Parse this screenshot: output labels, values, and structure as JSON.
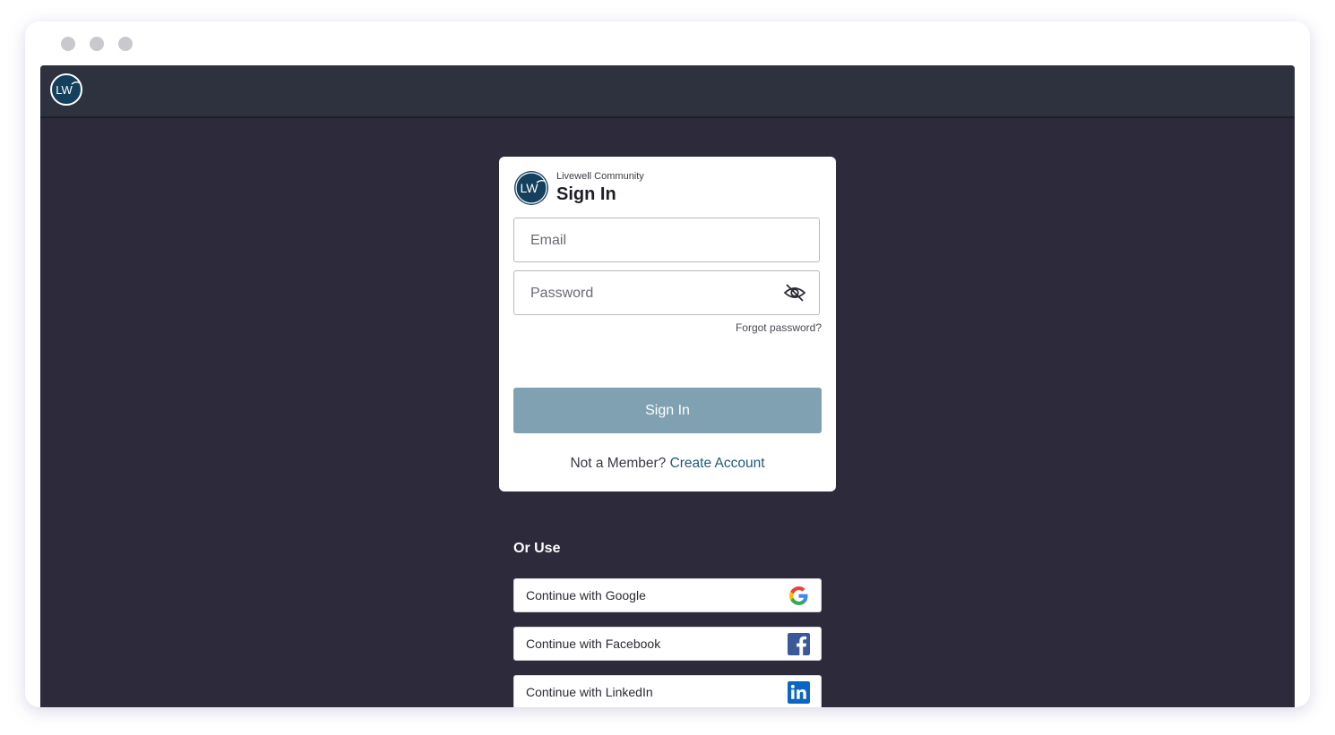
{
  "topbar": {
    "logo_text": "LW"
  },
  "card": {
    "logo_text": "LW",
    "subtitle": "Livewell Community",
    "title": "Sign In",
    "email": {
      "placeholder": "Email",
      "value": ""
    },
    "password": {
      "placeholder": "Password",
      "value": ""
    },
    "forgot_label": "Forgot password?",
    "submit_label": "Sign In",
    "member_prompt": "Not a Member?",
    "create_account_label": "Create Account"
  },
  "social": {
    "heading": "Or Use",
    "buttons": [
      {
        "label": "Continue with Google",
        "icon": "google-icon"
      },
      {
        "label": "Continue with Facebook",
        "icon": "facebook-icon"
      },
      {
        "label": "Continue with LinkedIn",
        "icon": "linkedin-icon"
      }
    ]
  },
  "colors": {
    "page_background": "#2c2a3b",
    "topbar_background": "#2d323e",
    "brand_navy": "#14405e",
    "submit_button": "#7fa1b1",
    "link": "#1f5a7a",
    "facebook": "#3b5998",
    "linkedin": "#0a66c2"
  }
}
